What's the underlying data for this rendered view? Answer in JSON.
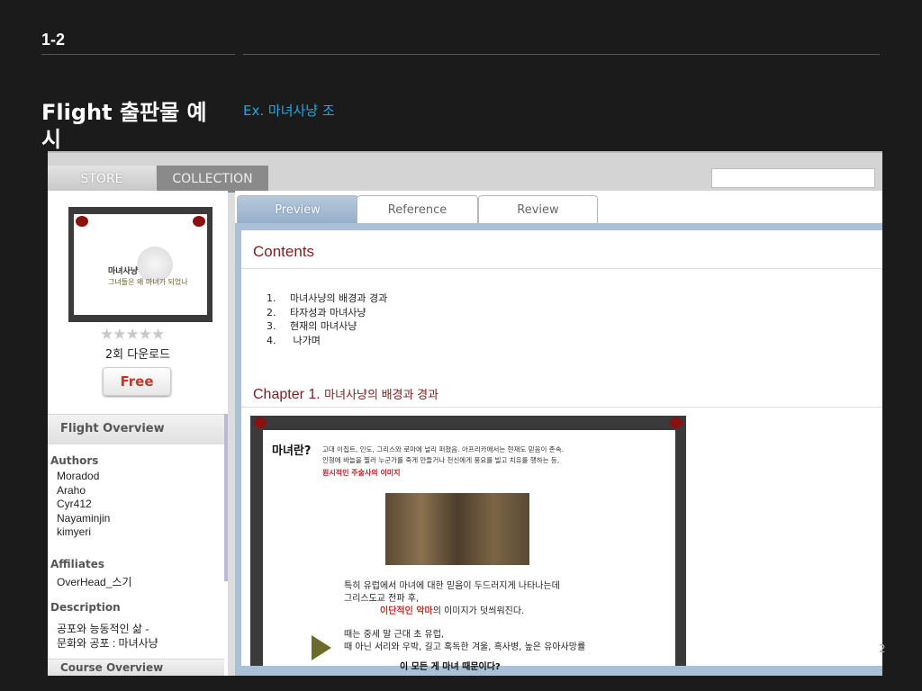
{
  "slide": {
    "number": "1-2",
    "title": "Flight 출판물 예시",
    "subtitle": "Ex. 마녀사냥 조",
    "page": "2"
  },
  "nav": {
    "store": "STORE",
    "collection": "COLLECTION"
  },
  "item": {
    "cover_title": "마녀사냥",
    "cover_subtitle": "그녀들은 왜 마녀가 되었나",
    "rating_stars": "★★★★★",
    "rating": 0,
    "downloads": "2회 다운로드",
    "price_button": "Free"
  },
  "overview": {
    "heading": "Flight Overview",
    "authors_label": "Authors",
    "authors": [
      "Moradod",
      "Araho",
      "Cyr412",
      "Nayaminjin",
      "kimyeri"
    ],
    "affiliates_label": "Affiliates",
    "affiliates": "OverHead_스기",
    "description_label": "Description",
    "description": [
      "공포와 능동적인 삶 -",
      "문화와 공포 : 마녀사냥"
    ],
    "course_overview": "Course Overview"
  },
  "tabs": {
    "preview": "Preview",
    "reference": "Reference",
    "review": "Review"
  },
  "preview": {
    "contents_heading": "Contents",
    "toc": [
      {
        "n": "1.",
        "t": "마녀사냥의 배경과 경과"
      },
      {
        "n": "2.",
        "t": "타자성과 마녀사냥"
      },
      {
        "n": "3.",
        "t": "현재의 마녀사냥"
      },
      {
        "n": "4.",
        "t": " 나가며"
      }
    ],
    "chapter_heading": "Chapter 1.",
    "chapter_title": "마녀사냥의 배경과 경과",
    "thumb": {
      "title": "마녀란?",
      "line1": "고대 이집트, 인도, 그리스와 로마에 널리 퍼졌음. 아프리카에서는 현재도 믿음이 존속.",
      "line2": "인형에 바늘을 찔러 누군가를 죽게 만들거나 천신에게 풍요를 빌고 치유를 행하는 등,",
      "line3": "원시적인 주술사의 이미지",
      "p1": "특히 유럽에서 마녀에 대한 믿음이 두드러지게 나타나는데",
      "p2": "그리스도교 전파 후,",
      "p3_red": "이단적인 악마",
      "p3_rest": "의 이미지가 덧씌워진다.",
      "p4": "때는 중세 말 근대 초 유럽,",
      "p5": "때 아닌 서리와 우박, 길고 혹독한 겨울, 흑사병, 높은 유아사망률",
      "p6": "이 모든 게 마녀 때문이다?"
    }
  }
}
